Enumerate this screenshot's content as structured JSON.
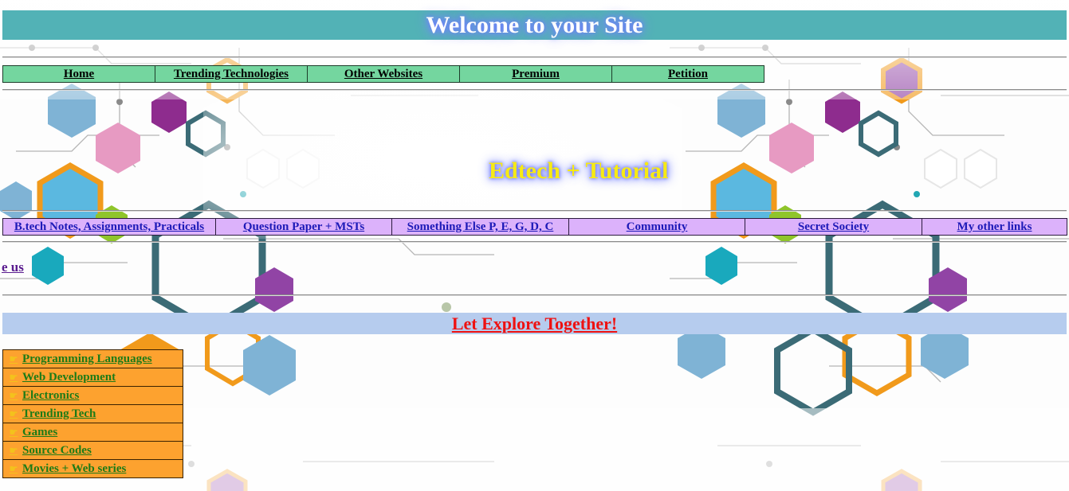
{
  "header": {
    "title": "Welcome to your Site"
  },
  "top_nav": {
    "items": [
      {
        "label": "Home"
      },
      {
        "label": "Trending Technologies"
      },
      {
        "label": "Other Websites"
      },
      {
        "label": "Premium"
      },
      {
        "label": "Petition"
      }
    ]
  },
  "mid_heading": "Edtech + Tutorial",
  "sub_nav": {
    "items": [
      {
        "label": "B.tech Notes, Assignments, Practicals"
      },
      {
        "label": "Question Paper + MSTs"
      },
      {
        "label": "Something Else P, E, G, D, C"
      },
      {
        "label": "Community"
      },
      {
        "label": "Secret Society"
      },
      {
        "label": "My other links"
      }
    ]
  },
  "marquee_fragment": "e us",
  "banner": {
    "label": "Let Explore Together!"
  },
  "side_list": {
    "icon": "hand-pointing-icon",
    "items": [
      {
        "label": "Programming Languages"
      },
      {
        "label": "Web Development"
      },
      {
        "label": "Electronics"
      },
      {
        "label": "Trending Tech"
      },
      {
        "label": "Games"
      },
      {
        "label": "Source Codes"
      },
      {
        "label": "Movies + Web series"
      }
    ]
  },
  "colors": {
    "header_bg": "#52b2b6",
    "top_nav_bg": "#74d69f",
    "sub_nav_bg": "#dcb2fb",
    "banner_bg": "#b6ccee",
    "banner_text": "#ee1111",
    "side_list_bg": "#fda22f",
    "side_list_text": "#1d7b17",
    "mid_heading_text": "#f7ea14"
  }
}
